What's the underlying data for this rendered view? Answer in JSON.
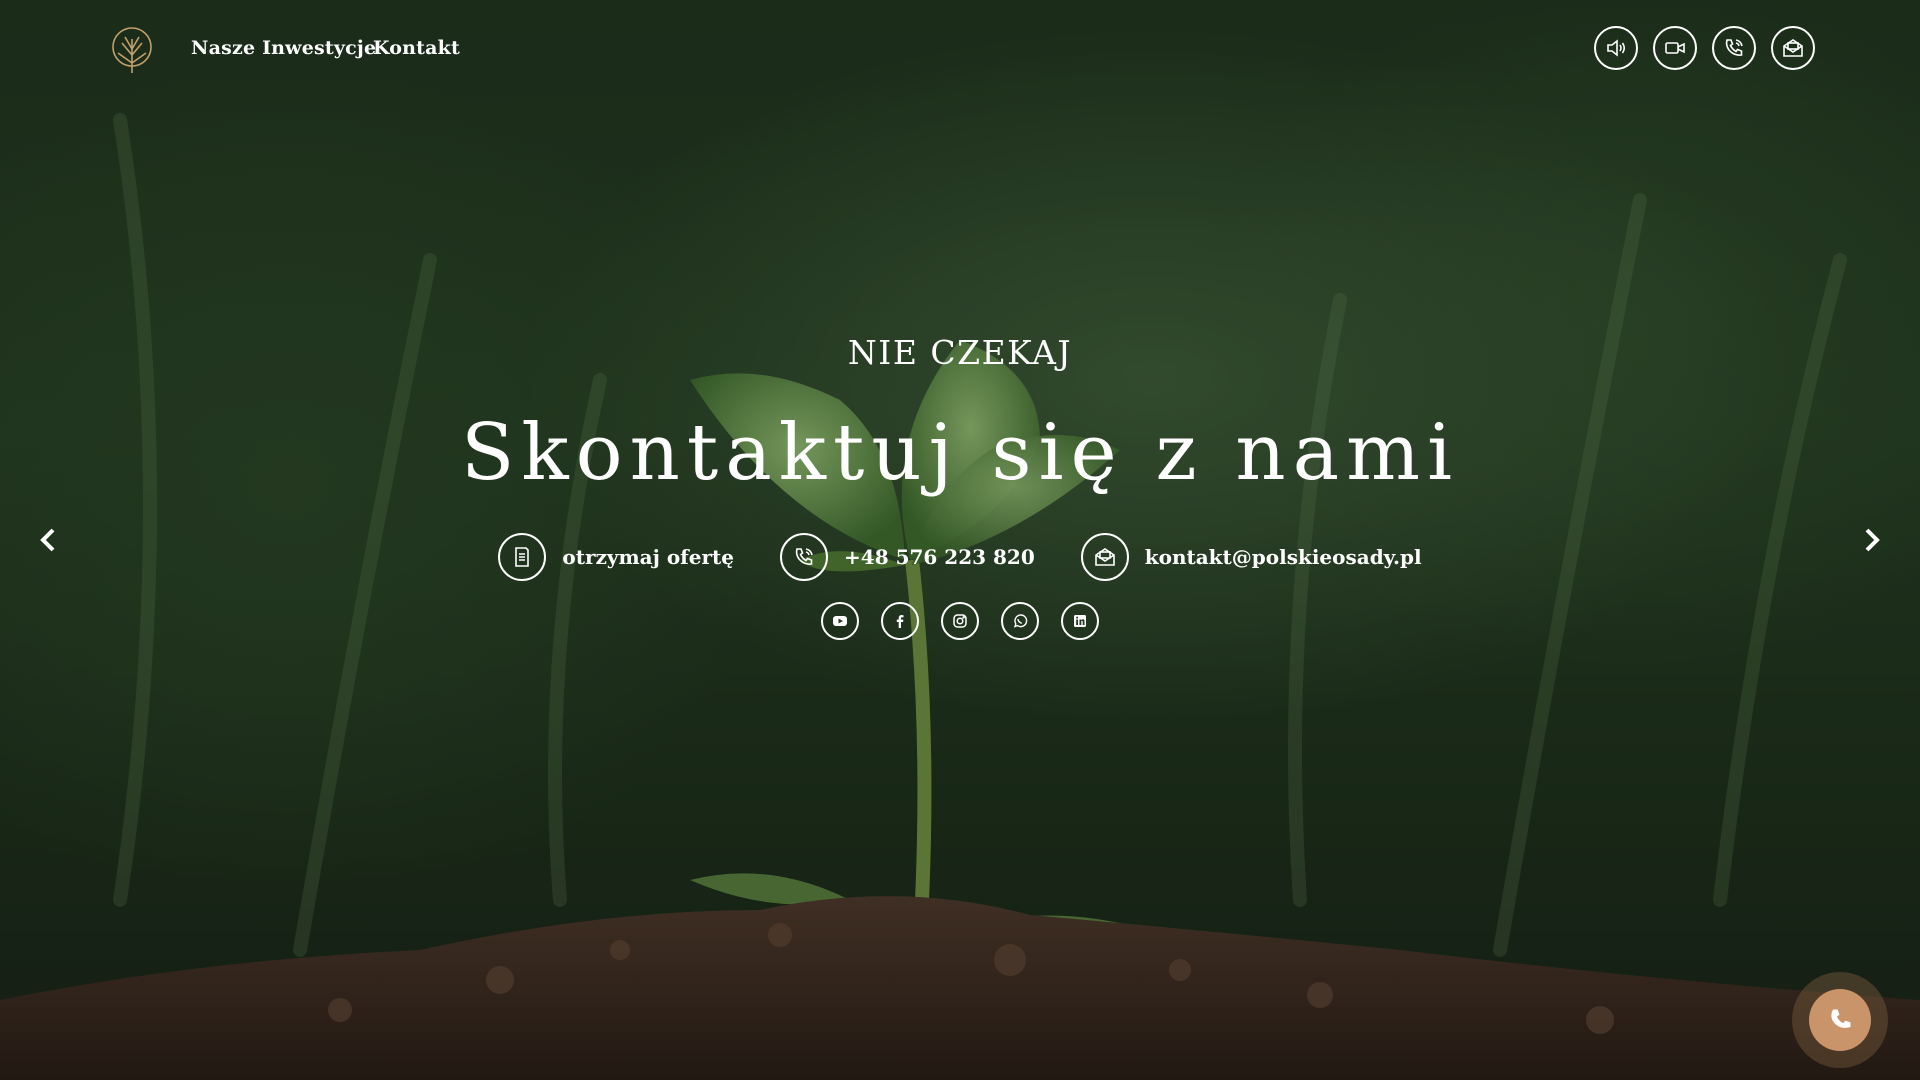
{
  "nav": {
    "links": [
      "Nasze Inwestycje",
      "Kontakt"
    ],
    "icons": [
      "audio-icon",
      "video-icon",
      "phone-icon",
      "mail-icon"
    ]
  },
  "hero": {
    "kicker": "NIE CZEKAJ",
    "headline": "Skontaktuj się z nami",
    "contacts": [
      {
        "icon": "document-icon",
        "text": "otrzymaj ofertę"
      },
      {
        "icon": "phone-icon",
        "text": "+48 576 223 820"
      },
      {
        "icon": "mail-icon",
        "text": "kontakt@polskieosady.pl"
      }
    ],
    "socials": [
      "youtube-icon",
      "facebook-icon",
      "instagram-icon",
      "whatsapp-icon",
      "linkedin-icon"
    ]
  },
  "colors": {
    "accent": "#c9946a",
    "text": "#ffffff",
    "logo": "#c2a06b"
  }
}
